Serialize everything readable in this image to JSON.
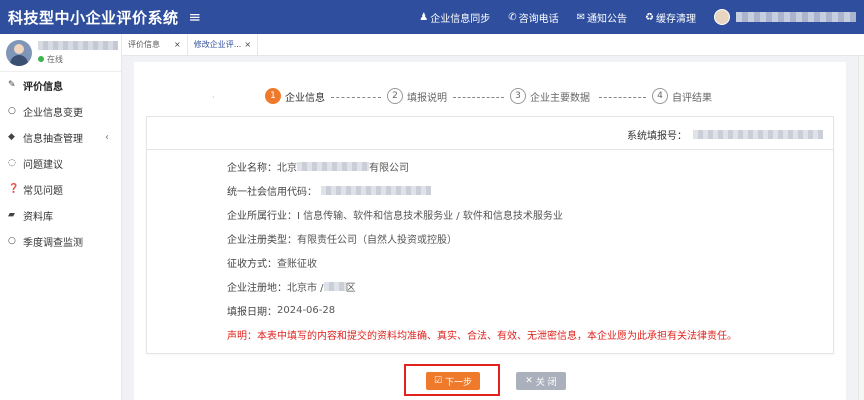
{
  "app": {
    "title": "科技型中小企业评价系统",
    "menu_icon": "hamburger-icon"
  },
  "top_actions": [
    {
      "icon": "user-icon",
      "glyph": "♟",
      "label": "企业信息同步"
    },
    {
      "icon": "phone-icon",
      "glyph": "✆",
      "label": "咨询电话"
    },
    {
      "icon": "envelope-icon",
      "glyph": "✉",
      "label": "通知公告"
    },
    {
      "icon": "recycle-icon",
      "glyph": "♻",
      "label": "缓存清理"
    }
  ],
  "user": {
    "status": "在线"
  },
  "sidebar": {
    "items": [
      {
        "icon": "edit-icon",
        "glyph": "✎",
        "label": "评价信息",
        "active": true
      },
      {
        "icon": "circle-icon",
        "glyph": "○",
        "label": "企业信息变更"
      },
      {
        "icon": "tags-icon",
        "glyph": "◆",
        "label": "信息抽查管理",
        "arrow": "‹"
      },
      {
        "icon": "comment-icon",
        "glyph": "◌",
        "label": "问题建议"
      },
      {
        "icon": "question-icon",
        "glyph": "❓",
        "label": "常见问题"
      },
      {
        "icon": "folder-icon",
        "glyph": "▰",
        "label": "资料库"
      },
      {
        "icon": "circle-icon",
        "glyph": "○",
        "label": "季度调查监测"
      }
    ]
  },
  "tabs": [
    {
      "label": "评价信息",
      "close": "×"
    },
    {
      "label": "修改企业评...",
      "close": "×"
    }
  ],
  "steps": {
    "dot": "·",
    "items": [
      {
        "num": "1",
        "label": "企业信息"
      },
      {
        "num": "2",
        "label": "填报说明"
      },
      {
        "num": "3",
        "label": "企业主要数据"
      },
      {
        "num": "4",
        "label": "自评结果"
      }
    ]
  },
  "form": {
    "sys_no_label": "系统填报号：",
    "company_name_label": "企业名称：",
    "company_name_prefix": "北京",
    "company_name_suffix": "有限公司",
    "credit_code_label": "统一社会信用代码：",
    "industry_label": "企业所属行业：",
    "industry_value": "I 信息传输、软件和信息技术服务业 / 软件和信息技术服务业",
    "reg_type_label": "企业注册类型：",
    "reg_type_value": "有限责任公司（自然人投资或控股）",
    "tax_label": "征收方式：",
    "tax_value": "查账征收",
    "location_label": "企业注册地：",
    "location_prefix": "北京市 / ",
    "location_suffix": "区",
    "date_label": "填报日期：",
    "date_value": "2024-06-28",
    "declaration": "声明：本表中填写的内容和提交的资料均准确、真实、合法、有效、无泄密信息，本企业愿为此承担有关法律责任。"
  },
  "buttons": {
    "next": "下一步",
    "next_icon": "☑",
    "close": "关 闭",
    "close_icon": "✕"
  },
  "colors": {
    "topbar": "#2f4f9e",
    "accent": "#f07a2b",
    "danger": "#e0231e",
    "close_btn": "#aab1bd"
  }
}
